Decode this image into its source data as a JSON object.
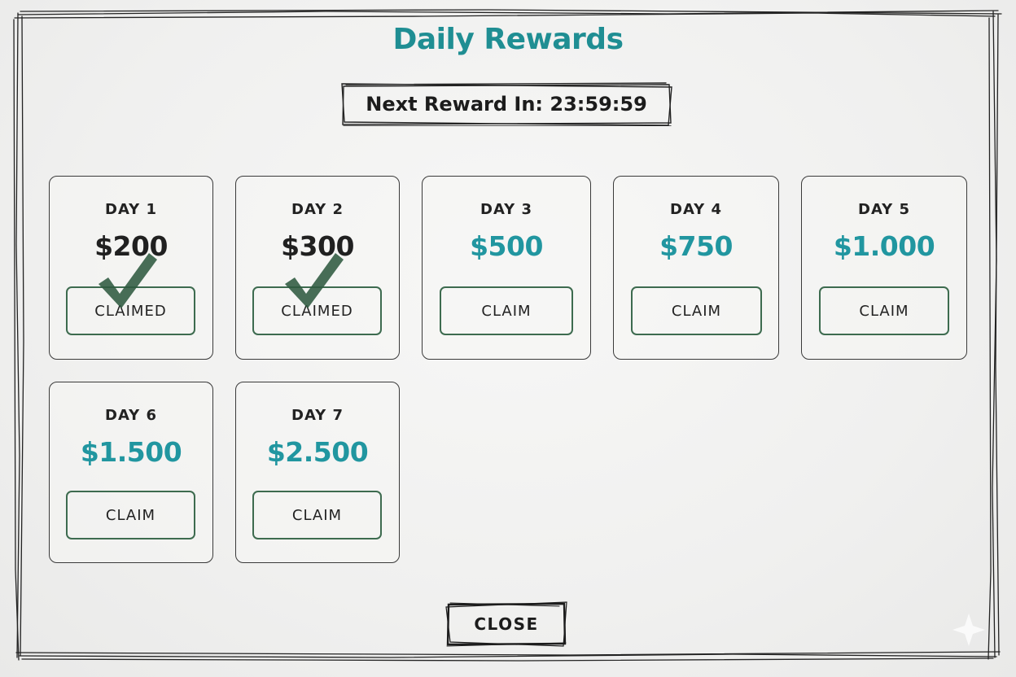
{
  "title": "Daily Rewards",
  "timer": {
    "text": "Next Reward In: 23:59:59"
  },
  "rewards": [
    {
      "day": "DAY 1",
      "amount": "$200",
      "button": "CLAIMED",
      "claimed": true
    },
    {
      "day": "DAY 2",
      "amount": "$300",
      "button": "CLAIMED",
      "claimed": true
    },
    {
      "day": "DAY 3",
      "amount": "$500",
      "button": "CLAIM",
      "claimed": false
    },
    {
      "day": "DAY 4",
      "amount": "$750",
      "button": "CLAIM",
      "claimed": false
    },
    {
      "day": "DAY 5",
      "amount": "$1.000",
      "button": "CLAIM",
      "claimed": false
    },
    {
      "day": "DAY 6",
      "amount": "$1.500",
      "button": "CLAIM",
      "claimed": false
    },
    {
      "day": "DAY 7",
      "amount": "$2.500",
      "button": "CLAIM",
      "claimed": false
    }
  ],
  "close_button": "CLOSE",
  "icons": {
    "claimed_mark": "checkmark-icon",
    "corner": "sparkle-icon"
  },
  "colors": {
    "accent": "#1f8e93",
    "amount_available": "#2196a0",
    "button_border": "#3d6b4f",
    "checkmark": "#2f5a40"
  }
}
